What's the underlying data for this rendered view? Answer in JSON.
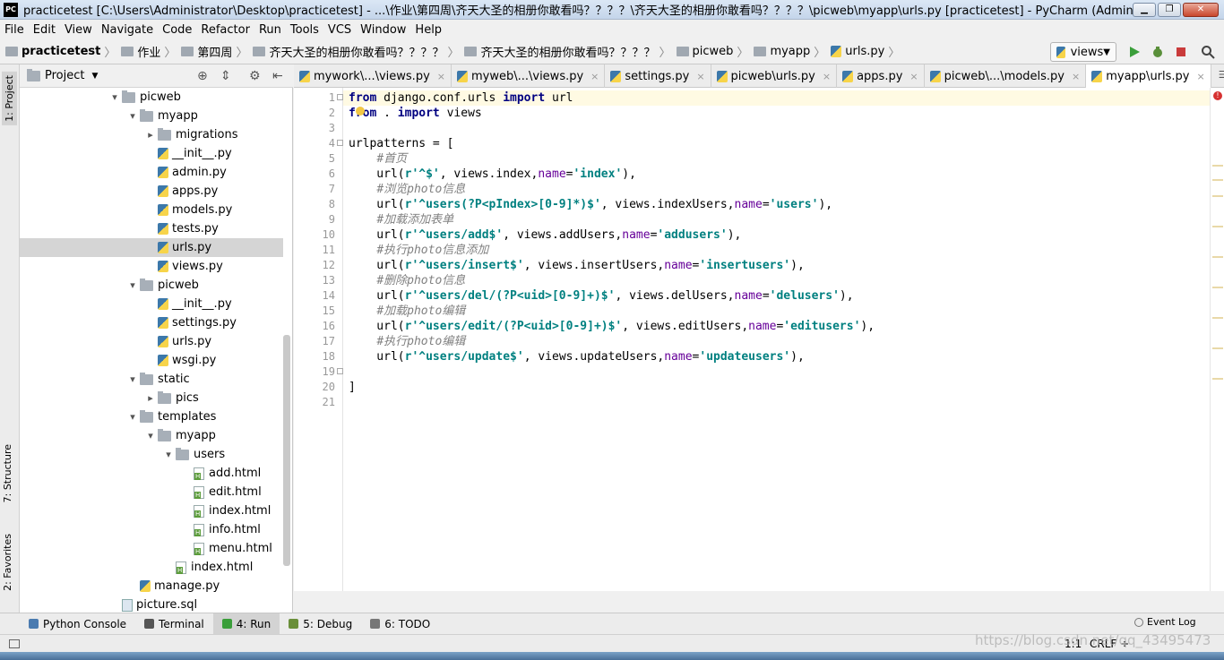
{
  "window": {
    "title": "practicetest [C:\\Users\\Administrator\\Desktop\\practicetest] - ...\\作业\\第四周\\齐天大圣的相册你敢看吗？？？？\\齐天大圣的相册你敢看吗？？？？\\picweb\\myapp\\urls.py [practicetest] - PyCharm (Administrator)",
    "logo": "PC"
  },
  "menu": [
    "File",
    "Edit",
    "View",
    "Navigate",
    "Code",
    "Refactor",
    "Run",
    "Tools",
    "VCS",
    "Window",
    "Help"
  ],
  "breadcrumb": [
    "practicetest",
    "作业",
    "第四周",
    "齐天大圣的相册你敢看吗？？？？",
    "齐天大圣的相册你敢看吗？？？？",
    "picweb",
    "myapp",
    "urls.py"
  ],
  "run_config": "views",
  "left_tabs": [
    "1: Project",
    "7: Structure",
    "2: Favorites"
  ],
  "project_panel": {
    "title": "Project"
  },
  "tree": [
    {
      "label": "picweb",
      "kind": "folder",
      "depth": 0,
      "arrow": "▾"
    },
    {
      "label": "myapp",
      "kind": "folder",
      "depth": 1,
      "arrow": "▾"
    },
    {
      "label": "migrations",
      "kind": "folder",
      "depth": 2,
      "arrow": "▸"
    },
    {
      "label": "__init__.py",
      "kind": "py",
      "depth": 2,
      "arrow": ""
    },
    {
      "label": "admin.py",
      "kind": "py",
      "depth": 2,
      "arrow": ""
    },
    {
      "label": "apps.py",
      "kind": "py",
      "depth": 2,
      "arrow": ""
    },
    {
      "label": "models.py",
      "kind": "py",
      "depth": 2,
      "arrow": ""
    },
    {
      "label": "tests.py",
      "kind": "py",
      "depth": 2,
      "arrow": ""
    },
    {
      "label": "urls.py",
      "kind": "py",
      "depth": 2,
      "arrow": "",
      "selected": true
    },
    {
      "label": "views.py",
      "kind": "py",
      "depth": 2,
      "arrow": ""
    },
    {
      "label": "picweb",
      "kind": "folder",
      "depth": 1,
      "arrow": "▾"
    },
    {
      "label": "__init__.py",
      "kind": "py",
      "depth": 2,
      "arrow": ""
    },
    {
      "label": "settings.py",
      "kind": "py",
      "depth": 2,
      "arrow": ""
    },
    {
      "label": "urls.py",
      "kind": "py",
      "depth": 2,
      "arrow": ""
    },
    {
      "label": "wsgi.py",
      "kind": "py",
      "depth": 2,
      "arrow": ""
    },
    {
      "label": "static",
      "kind": "folder",
      "depth": 1,
      "arrow": "▾"
    },
    {
      "label": "pics",
      "kind": "folder",
      "depth": 2,
      "arrow": "▸"
    },
    {
      "label": "templates",
      "kind": "folder",
      "depth": 1,
      "arrow": "▾"
    },
    {
      "label": "myapp",
      "kind": "folder",
      "depth": 2,
      "arrow": "▾"
    },
    {
      "label": "users",
      "kind": "folder",
      "depth": 3,
      "arrow": "▾"
    },
    {
      "label": "add.html",
      "kind": "html",
      "depth": 4,
      "arrow": ""
    },
    {
      "label": "edit.html",
      "kind": "html",
      "depth": 4,
      "arrow": ""
    },
    {
      "label": "index.html",
      "kind": "html",
      "depth": 4,
      "arrow": ""
    },
    {
      "label": "info.html",
      "kind": "html",
      "depth": 4,
      "arrow": ""
    },
    {
      "label": "menu.html",
      "kind": "html",
      "depth": 4,
      "arrow": ""
    },
    {
      "label": "index.html",
      "kind": "html",
      "depth": 3,
      "arrow": ""
    },
    {
      "label": "manage.py",
      "kind": "py",
      "depth": 1,
      "arrow": ""
    },
    {
      "label": "picture.sql",
      "kind": "sql",
      "depth": 0,
      "arrow": ""
    }
  ],
  "editor_tabs": [
    {
      "label": "mywork\\...\\views.py"
    },
    {
      "label": "myweb\\...\\views.py"
    },
    {
      "label": "settings.py"
    },
    {
      "label": "picweb\\urls.py"
    },
    {
      "label": "apps.py"
    },
    {
      "label": "picweb\\...\\models.py"
    },
    {
      "label": "myapp\\urls.py",
      "active": true
    }
  ],
  "code": [
    [
      [
        "kw",
        "from"
      ],
      [
        "t",
        " django.conf.urls "
      ],
      [
        "kw",
        "import"
      ],
      [
        "t",
        " url"
      ]
    ],
    [
      [
        "kw",
        "from"
      ],
      [
        "t",
        " . "
      ],
      [
        "kw",
        "import"
      ],
      [
        "t",
        " views"
      ]
    ],
    [],
    [
      [
        "t",
        "urlpatterns = ["
      ]
    ],
    [
      [
        "t",
        "    "
      ],
      [
        "cm",
        "#首页"
      ]
    ],
    [
      [
        "t",
        "    url("
      ],
      [
        "str",
        "r'^$'"
      ],
      [
        "t",
        ", views.index,"
      ],
      [
        "pm",
        "name"
      ],
      [
        "t",
        "="
      ],
      [
        "str",
        "'index'"
      ],
      [
        "t",
        "),"
      ]
    ],
    [
      [
        "t",
        "    "
      ],
      [
        "cm",
        "#浏览photo信息"
      ]
    ],
    [
      [
        "t",
        "    url("
      ],
      [
        "str",
        "r'^users(?P<pIndex>[0-9]*)$'"
      ],
      [
        "t",
        ", views.indexUsers,"
      ],
      [
        "pm",
        "name"
      ],
      [
        "t",
        "="
      ],
      [
        "str",
        "'users'"
      ],
      [
        "t",
        "),"
      ]
    ],
    [
      [
        "t",
        "    "
      ],
      [
        "cm",
        "#加载添加表单"
      ]
    ],
    [
      [
        "t",
        "    url("
      ],
      [
        "str",
        "r'^users/add$'"
      ],
      [
        "t",
        ", views.addUsers,"
      ],
      [
        "pm",
        "name"
      ],
      [
        "t",
        "="
      ],
      [
        "str",
        "'addusers'"
      ],
      [
        "t",
        "),"
      ]
    ],
    [
      [
        "t",
        "    "
      ],
      [
        "cm",
        "#执行photo信息添加"
      ]
    ],
    [
      [
        "t",
        "    url("
      ],
      [
        "str",
        "r'^users/insert$'"
      ],
      [
        "t",
        ", views.insertUsers,"
      ],
      [
        "pm",
        "name"
      ],
      [
        "t",
        "="
      ],
      [
        "str",
        "'insertusers'"
      ],
      [
        "t",
        "),"
      ]
    ],
    [
      [
        "t",
        "    "
      ],
      [
        "cm",
        "#删除photo信息"
      ]
    ],
    [
      [
        "t",
        "    url("
      ],
      [
        "str",
        "r'^users/del/(?P<uid>[0-9]+)$'"
      ],
      [
        "t",
        ", views.delUsers,"
      ],
      [
        "pm",
        "name"
      ],
      [
        "t",
        "="
      ],
      [
        "str",
        "'delusers'"
      ],
      [
        "t",
        "),"
      ]
    ],
    [
      [
        "t",
        "    "
      ],
      [
        "cm",
        "#加载photo编辑"
      ]
    ],
    [
      [
        "t",
        "    url("
      ],
      [
        "str",
        "r'^users/edit/(?P<uid>[0-9]+)$'"
      ],
      [
        "t",
        ", views.editUsers,"
      ],
      [
        "pm",
        "name"
      ],
      [
        "t",
        "="
      ],
      [
        "str",
        "'editusers'"
      ],
      [
        "t",
        "),"
      ]
    ],
    [
      [
        "t",
        "    "
      ],
      [
        "cm",
        "#执行photo编辑"
      ]
    ],
    [
      [
        "t",
        "    url("
      ],
      [
        "str",
        "r'^users/update$'"
      ],
      [
        "t",
        ", views.updateUsers,"
      ],
      [
        "pm",
        "name"
      ],
      [
        "t",
        "="
      ],
      [
        "str",
        "'updateusers'"
      ],
      [
        "t",
        "),"
      ]
    ],
    [],
    [
      [
        "t",
        "]"
      ]
    ],
    []
  ],
  "bottom_tabs": [
    {
      "label": "Python Console",
      "icon": "python-console-icon"
    },
    {
      "label": "Terminal",
      "icon": "terminal-icon"
    },
    {
      "label": "4: Run",
      "icon": "run-icon",
      "active": true
    },
    {
      "label": "5: Debug",
      "icon": "debug-icon"
    },
    {
      "label": "6: TODO",
      "icon": "todo-icon"
    }
  ],
  "event_log": "Event Log",
  "status": {
    "position": "1:1",
    "line_sep": "CRLF ÷"
  },
  "watermark": "https://blog.csdn.net/qq_43495473"
}
